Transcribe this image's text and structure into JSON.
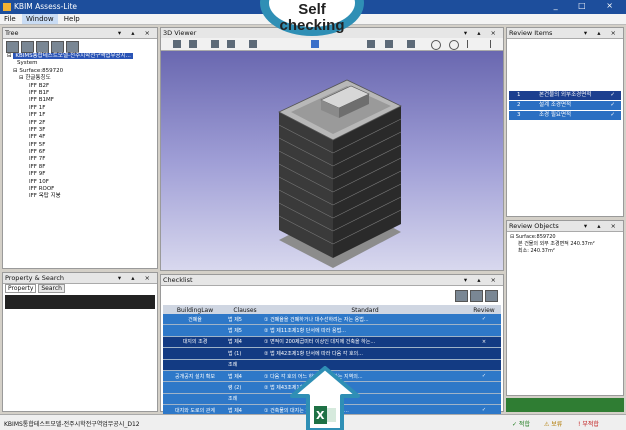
{
  "window": {
    "title": "KBIM Assess-Lite",
    "controls": "_ □ ×"
  },
  "menu": [
    "File",
    "Window",
    "Help"
  ],
  "tree_panel": {
    "title": "Tree",
    "controls": "▾ ▴ ×",
    "items": [
      "KBIMS통합테스트모델-전주시학전구역업무공시...",
      "System",
      "Surface:859720",
      "한글통칭도",
      "IFF B2F",
      "IFF B1F",
      "IFF B1MF",
      "IFF 1F",
      "IFF 1F",
      "IFF 2F",
      "IFF 3F",
      "IFF 4F",
      "IFF 5F",
      "IFF 6F",
      "IFF 7F",
      "IFF 8F",
      "IFF 9F",
      "IFF 10F",
      "IFF ROOF",
      "IFF 옥탑 지붕"
    ]
  },
  "property_panel": {
    "title": "Property & Search",
    "tabs": [
      "Property",
      "Search"
    ],
    "controls": "▾ ▴ ×"
  },
  "viewer": {
    "title": "3D Viewer",
    "controls": "▾ ▴ ×"
  },
  "review_items": {
    "title": "Review Items",
    "controls": "▾ ▴ ×",
    "rows": [
      {
        "num": "1",
        "name": "본건물의 외부조경면적",
        "mark": "✓"
      },
      {
        "num": "2",
        "name": "설계 조경면적",
        "mark": "✓"
      },
      {
        "num": "3",
        "name": "조경 필요면적",
        "mark": "✓"
      }
    ]
  },
  "review_objects": {
    "title": "Review Objects",
    "controls": "▾ ▴ ×",
    "items": [
      "Surface:859720",
      "본 건물의 외부 조경면적 240.37m²",
      "최소: 240.37m²"
    ]
  },
  "checklist": {
    "title": "Checklist",
    "controls": "▾ ▴ ×",
    "columns": [
      "BuildingLaw",
      "Clauses",
      "Standard",
      "Review"
    ],
    "rows": [
      {
        "law": "건폐율",
        "clause": "법 제5",
        "standard": "① 건폐율을 건폐하거나 대수선하려는 자는 용법...",
        "review": "✓",
        "color": "#2e78c8"
      },
      {
        "law": "",
        "clause": "법 제5",
        "standard": "② 법 제11조제1항 단서에 따라 용법...",
        "review": "",
        "color": "#2e78c8"
      },
      {
        "law": "대지의 조경",
        "clause": "법 제4",
        "standard": "① 면적이 200제곱미터 이상인 대지에 건축을 하는...",
        "review": "×",
        "color": "#133b83"
      },
      {
        "law": "",
        "clause": "법 (1)",
        "standard": "② 법 제42조제1항 단서에 따라 다음 각 호의...",
        "review": "",
        "color": "#133b83"
      },
      {
        "law": "",
        "clause": "조례",
        "standard": "",
        "review": "",
        "color": "#133b83"
      },
      {
        "law": "공개공지 설치 확보",
        "clause": "법 제4",
        "standard": "① 다음 각 호의 어느 하나에 해당하는 지역의...",
        "review": "✓",
        "color": "#2e78c8"
      },
      {
        "law": "",
        "clause": "령 (2)",
        "standard": "② 법 제43조제1항에 따라 다음 각 호의...",
        "review": "",
        "color": "#2e78c8"
      },
      {
        "law": "",
        "clause": "조례",
        "standard": "",
        "review": "",
        "color": "#2e78c8"
      },
      {
        "law": "대지와 도로의 관계",
        "clause": "법 제4",
        "standard": "① 건축물의 대지는 2미터 이상이 도로...",
        "review": "✓",
        "color": "#2e78c8"
      }
    ]
  },
  "statusbar": {
    "text": "KBIMS통합테스트모델-전주시학전구역업무공시_D12",
    "pass": "✓ 적합",
    "warn": "⚠ 보류",
    "fail": "! 부적합"
  },
  "overlay": {
    "line1": "Self",
    "line2": "checking"
  },
  "colors": {
    "titlebar": "#1d4e9c",
    "selected": "#2a54b6",
    "checklist_dark": "#133b83",
    "checklist_light": "#2e78c8",
    "arrow": "#2f8fb5"
  }
}
